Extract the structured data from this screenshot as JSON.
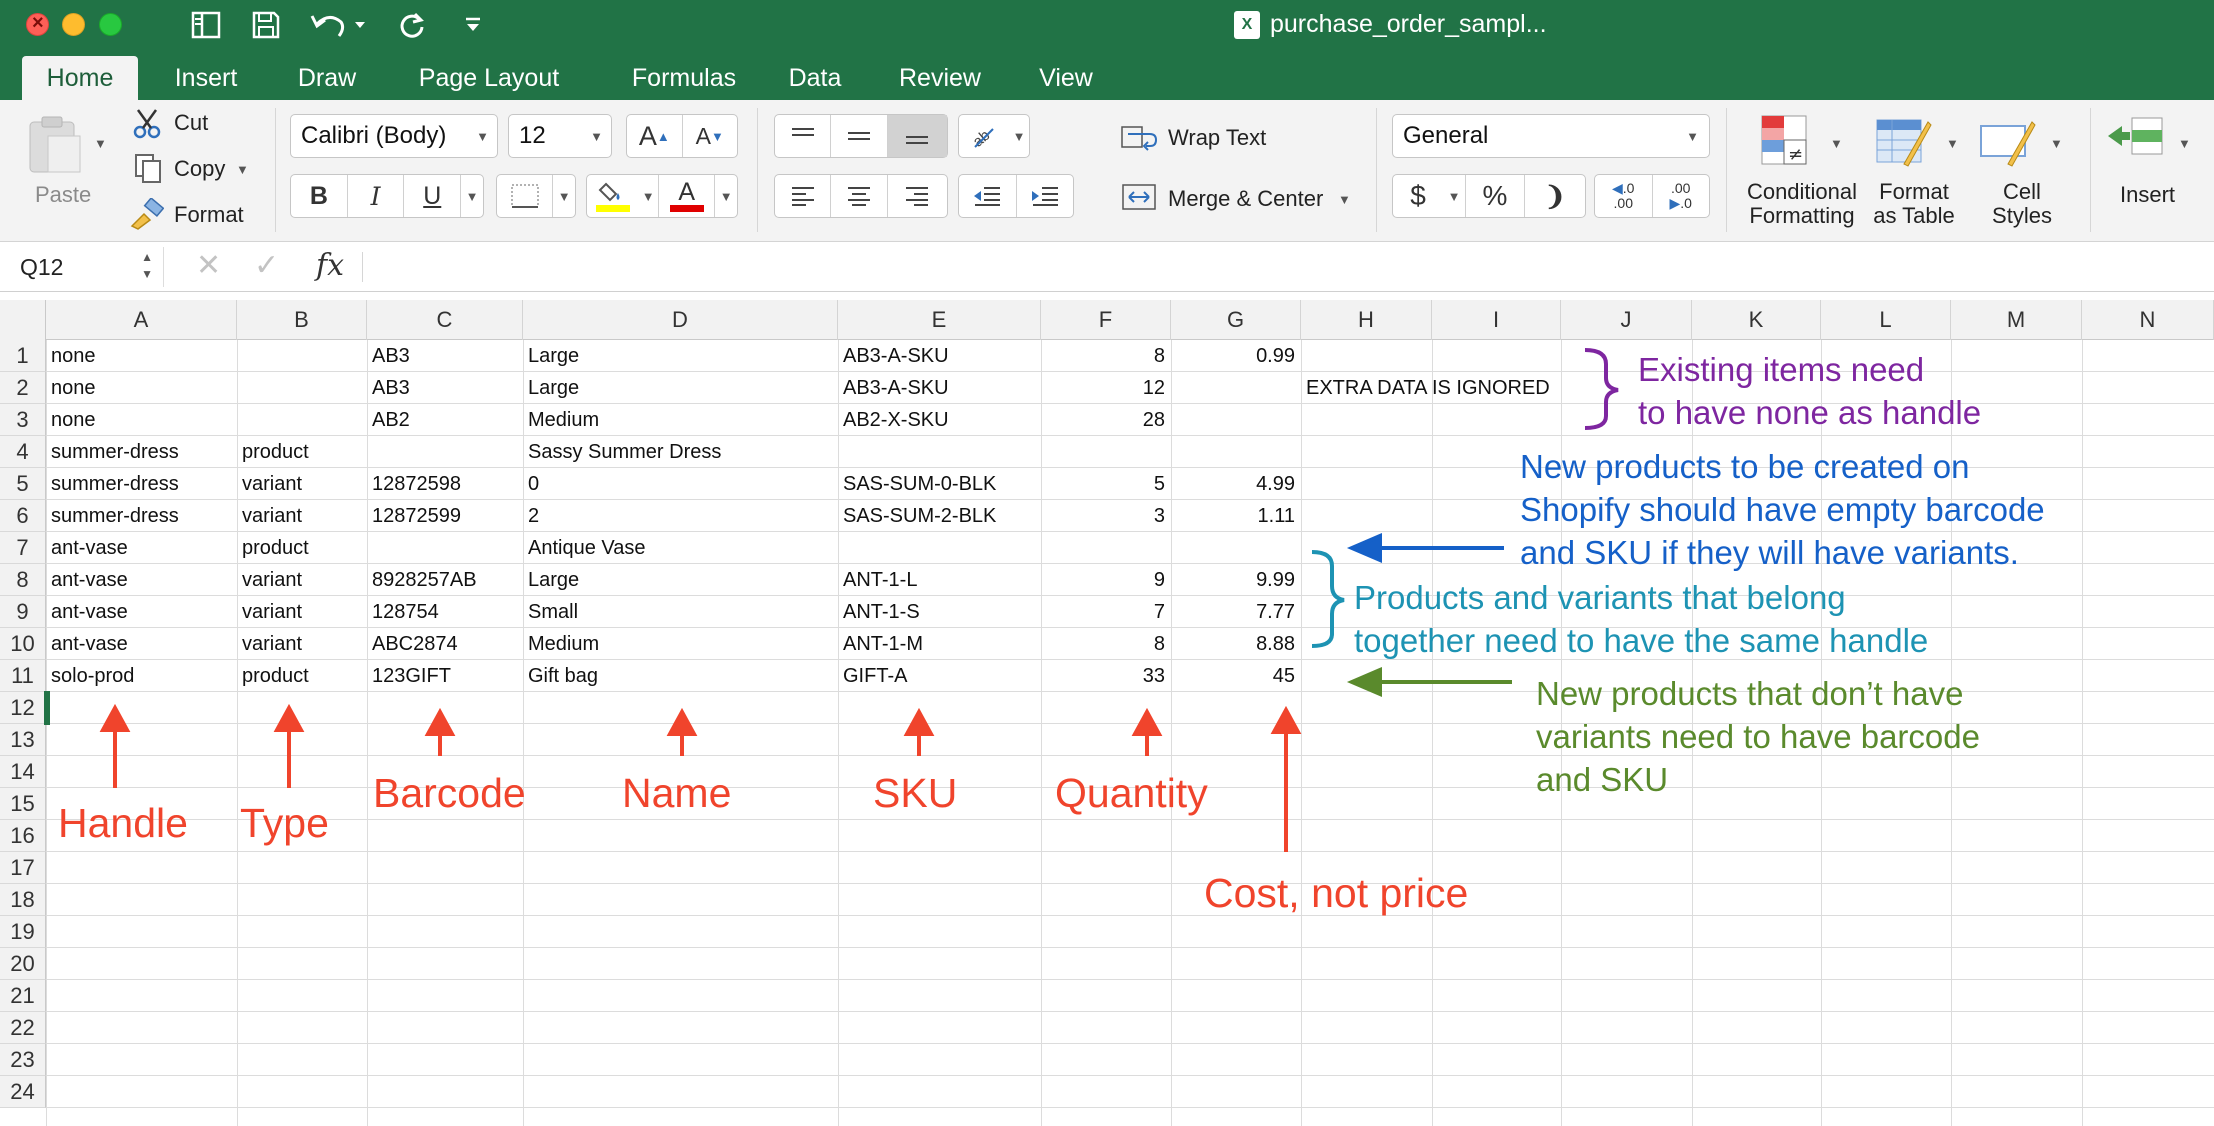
{
  "window": {
    "title": "purchase_order_sampl..."
  },
  "tabs": [
    "Home",
    "Insert",
    "Draw",
    "Page Layout",
    "Formulas",
    "Data",
    "Review",
    "View"
  ],
  "ribbon": {
    "paste": "Paste",
    "cut": "Cut",
    "copy": "Copy",
    "format": "Format",
    "font_name": "Calibri (Body)",
    "font_size": "12",
    "bold": "B",
    "italic": "I",
    "underline": "U",
    "wrap_text": "Wrap Text",
    "merge_center": "Merge & Center",
    "number_format": "General",
    "currency": "$",
    "percent": "%",
    "comma": "❩",
    "conditional_formatting": [
      "Conditional",
      "Formatting"
    ],
    "format_as_table": [
      "Format",
      "as Table"
    ],
    "cell_styles": [
      "Cell",
      "Styles"
    ],
    "insert": "Insert",
    "colors": {
      "highlight": "#ffff00",
      "font_color": "#e00000"
    }
  },
  "formula_bar": {
    "name_box": "Q12",
    "fx": "fx",
    "value": ""
  },
  "sheet": {
    "columns": [
      "A",
      "B",
      "C",
      "D",
      "E",
      "F",
      "G",
      "H",
      "I",
      "J",
      "K",
      "L",
      "M",
      "N"
    ],
    "row_numbers": [
      "1",
      "2",
      "3",
      "4",
      "5",
      "6",
      "7",
      "8",
      "9",
      "10",
      "11",
      "12",
      "13",
      "14",
      "15",
      "16",
      "17",
      "18",
      "19",
      "20",
      "21",
      "22",
      "23",
      "24"
    ],
    "rows": [
      [
        "none",
        "",
        "AB3",
        "Large",
        "AB3-A-SKU",
        "8",
        "0.99",
        ""
      ],
      [
        "none",
        "",
        "AB3",
        "Large",
        "AB3-A-SKU",
        "12",
        "",
        "EXTRA DATA IS IGNORED"
      ],
      [
        "none",
        "",
        "AB2",
        "Medium",
        "AB2-X-SKU",
        "28",
        "",
        ""
      ],
      [
        "summer-dress",
        "product",
        "",
        "Sassy Summer Dress",
        "",
        "",
        "",
        ""
      ],
      [
        "summer-dress",
        "variant",
        "12872598",
        "0",
        "SAS-SUM-0-BLK",
        "5",
        "4.99",
        ""
      ],
      [
        "summer-dress",
        "variant",
        "12872599",
        "2",
        "SAS-SUM-2-BLK",
        "3",
        "1.11",
        ""
      ],
      [
        "ant-vase",
        "product",
        "",
        "Antique Vase",
        "",
        "",
        "",
        ""
      ],
      [
        "ant-vase",
        "variant",
        "8928257AB",
        "Large",
        "ANT-1-L",
        "9",
        "9.99",
        ""
      ],
      [
        "ant-vase",
        "variant",
        "128754",
        "Small",
        "ANT-1-S",
        "7",
        "7.77",
        ""
      ],
      [
        "ant-vase",
        "variant",
        "ABC2874",
        "Medium",
        "ANT-1-M",
        "8",
        "8.88",
        ""
      ],
      [
        "solo-prod",
        "product",
        "123GIFT",
        "Gift bag",
        "GIFT-A",
        "33",
        "45",
        ""
      ]
    ]
  },
  "annotations": {
    "handle": "Handle",
    "type": "Type",
    "barcode": "Barcode",
    "name": "Name",
    "sku": "SKU",
    "quantity": "Quantity",
    "cost": "Cost, not price",
    "existing_items": [
      "Existing items need",
      "to have none as handle"
    ],
    "new_products_variants": [
      "New products to be created on",
      "Shopify should have empty barcode",
      "and SKU if they will have variants."
    ],
    "same_handle": [
      "Products and variants that belong",
      "together need to have the same handle"
    ],
    "no_variants": [
      "New products that don’t have",
      "variants need to have barcode",
      "and SKU"
    ],
    "colors": {
      "red": "#f0442c",
      "purple": "#7e26a0",
      "blue": "#1560c8",
      "teal": "#1d93b3",
      "green": "#5a8a2c"
    }
  }
}
